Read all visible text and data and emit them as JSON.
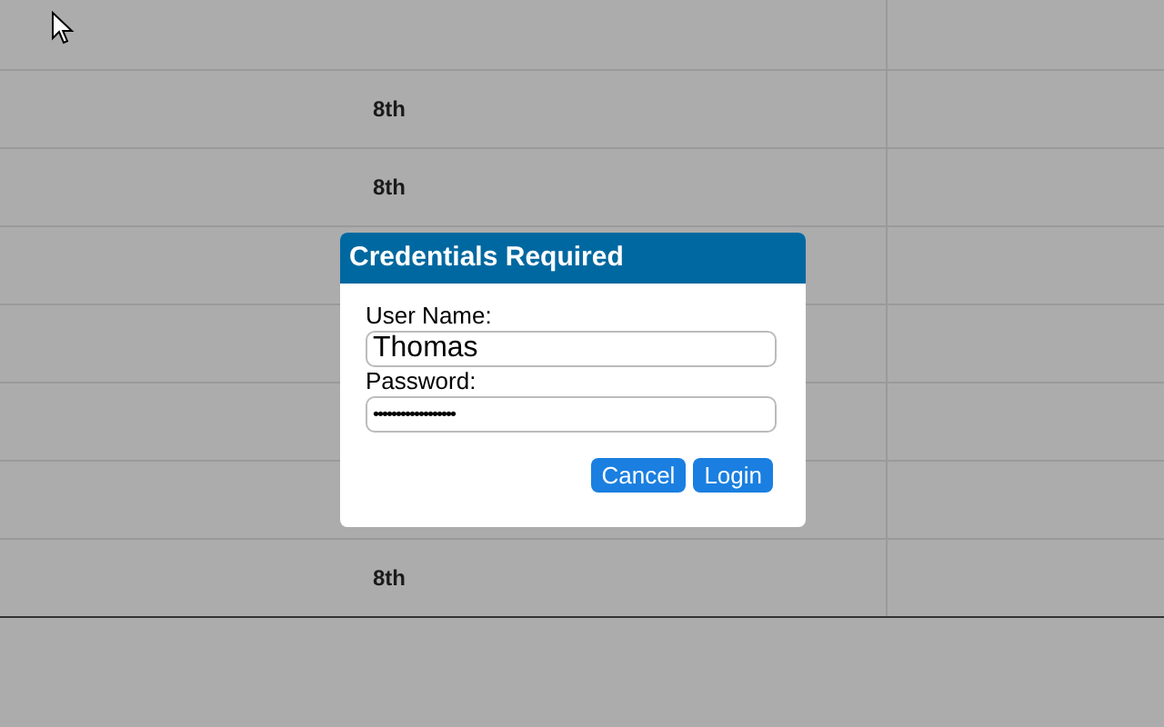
{
  "table": {
    "rows": [
      {
        "column_2": null
      },
      {
        "column_2": "8th"
      },
      {
        "column_2": "8th"
      },
      {
        "column_2": null
      },
      {
        "column_2": null
      },
      {
        "column_2": null
      },
      {
        "column_2": null
      },
      {
        "column_2": "8th"
      }
    ]
  },
  "dialog": {
    "title": "Credentials Required",
    "fields": [
      {
        "label": "User Name:",
        "value": "Thomas",
        "kind": "text"
      },
      {
        "label": "Password:",
        "value": "••••••••••••••••••",
        "kind": "password"
      }
    ],
    "buttons": [
      "Cancel",
      "Login"
    ]
  }
}
